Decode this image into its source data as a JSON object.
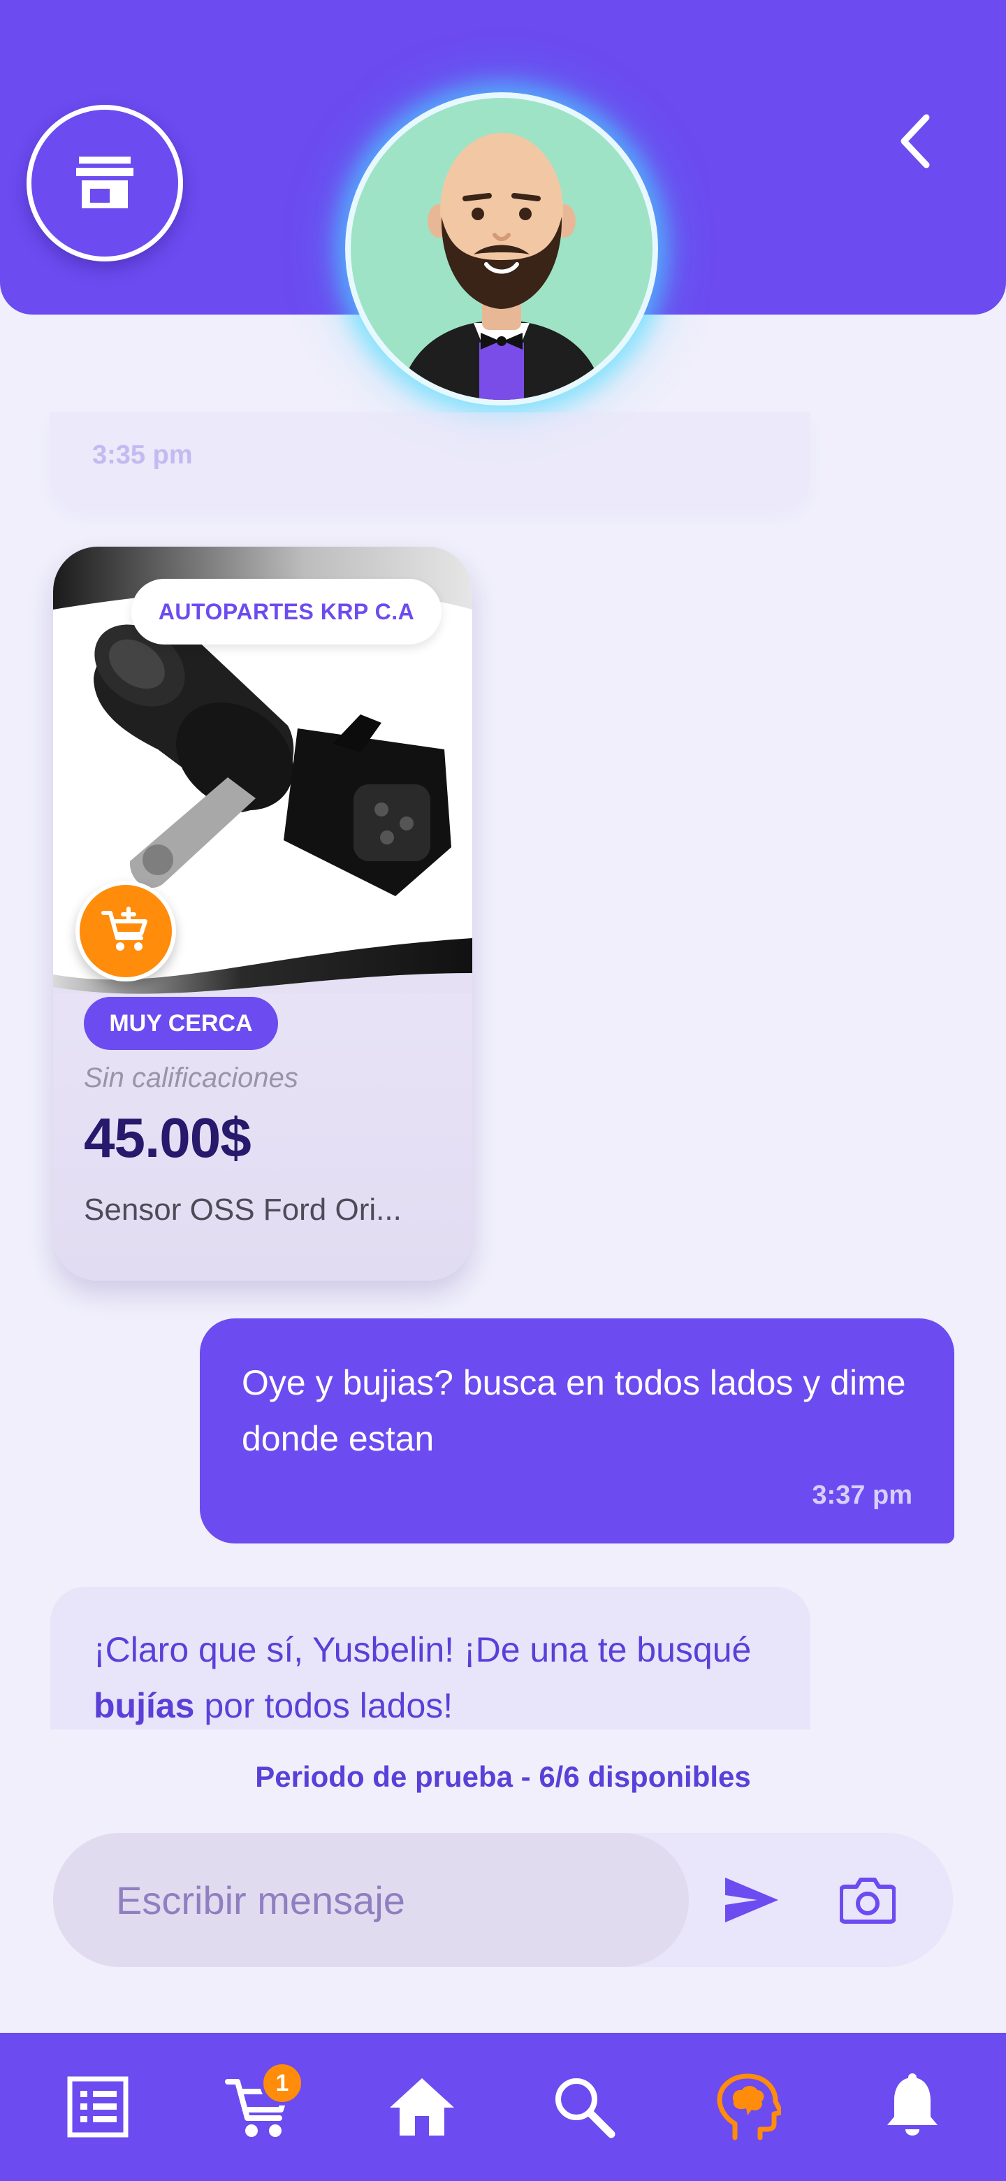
{
  "header": {
    "store_icon": "store-icon",
    "back_icon": "chevron-left-icon",
    "avatar": "assistant-avatar"
  },
  "chat": {
    "previous_message": {
      "time": "3:35 pm"
    },
    "product_card": {
      "seller": "AUTOPARTES KRP C.A",
      "distance_badge": "MUY CERCA",
      "rating": "Sin calificaciones",
      "price": "45.00$",
      "name": "Sensor OSS Ford Ori...",
      "add_to_cart_icon": "cart-plus-icon"
    },
    "user_message": {
      "text": "Oye y bujias? busca en todos lados y dime donde estan",
      "time": "3:37 pm"
    },
    "bot_message": {
      "text_before": "¡Claro que sí, Yusbelin! ¡De una te busqué ",
      "text_bold": "bujías",
      "text_after": " por todos lados!"
    }
  },
  "composer": {
    "trial_status": "Periodo de prueba - 6/6 disponibles",
    "placeholder": "Escribir mensaje",
    "send_icon": "send-icon",
    "camera_icon": "camera-icon"
  },
  "bottom_nav": {
    "items": [
      {
        "id": "orders",
        "icon": "list-icon"
      },
      {
        "id": "cart",
        "icon": "cart-icon",
        "badge": "1"
      },
      {
        "id": "home",
        "icon": "home-icon"
      },
      {
        "id": "search",
        "icon": "search-icon"
      },
      {
        "id": "assistant",
        "icon": "assistant-head-icon",
        "active": true
      },
      {
        "id": "notifications",
        "icon": "bell-icon"
      }
    ]
  },
  "colors": {
    "primary": "#6C4BF0",
    "accent": "#FF8C0A",
    "background": "#F0EFFB",
    "bubble_bot": "#E8E5FA",
    "price": "#27196B"
  }
}
